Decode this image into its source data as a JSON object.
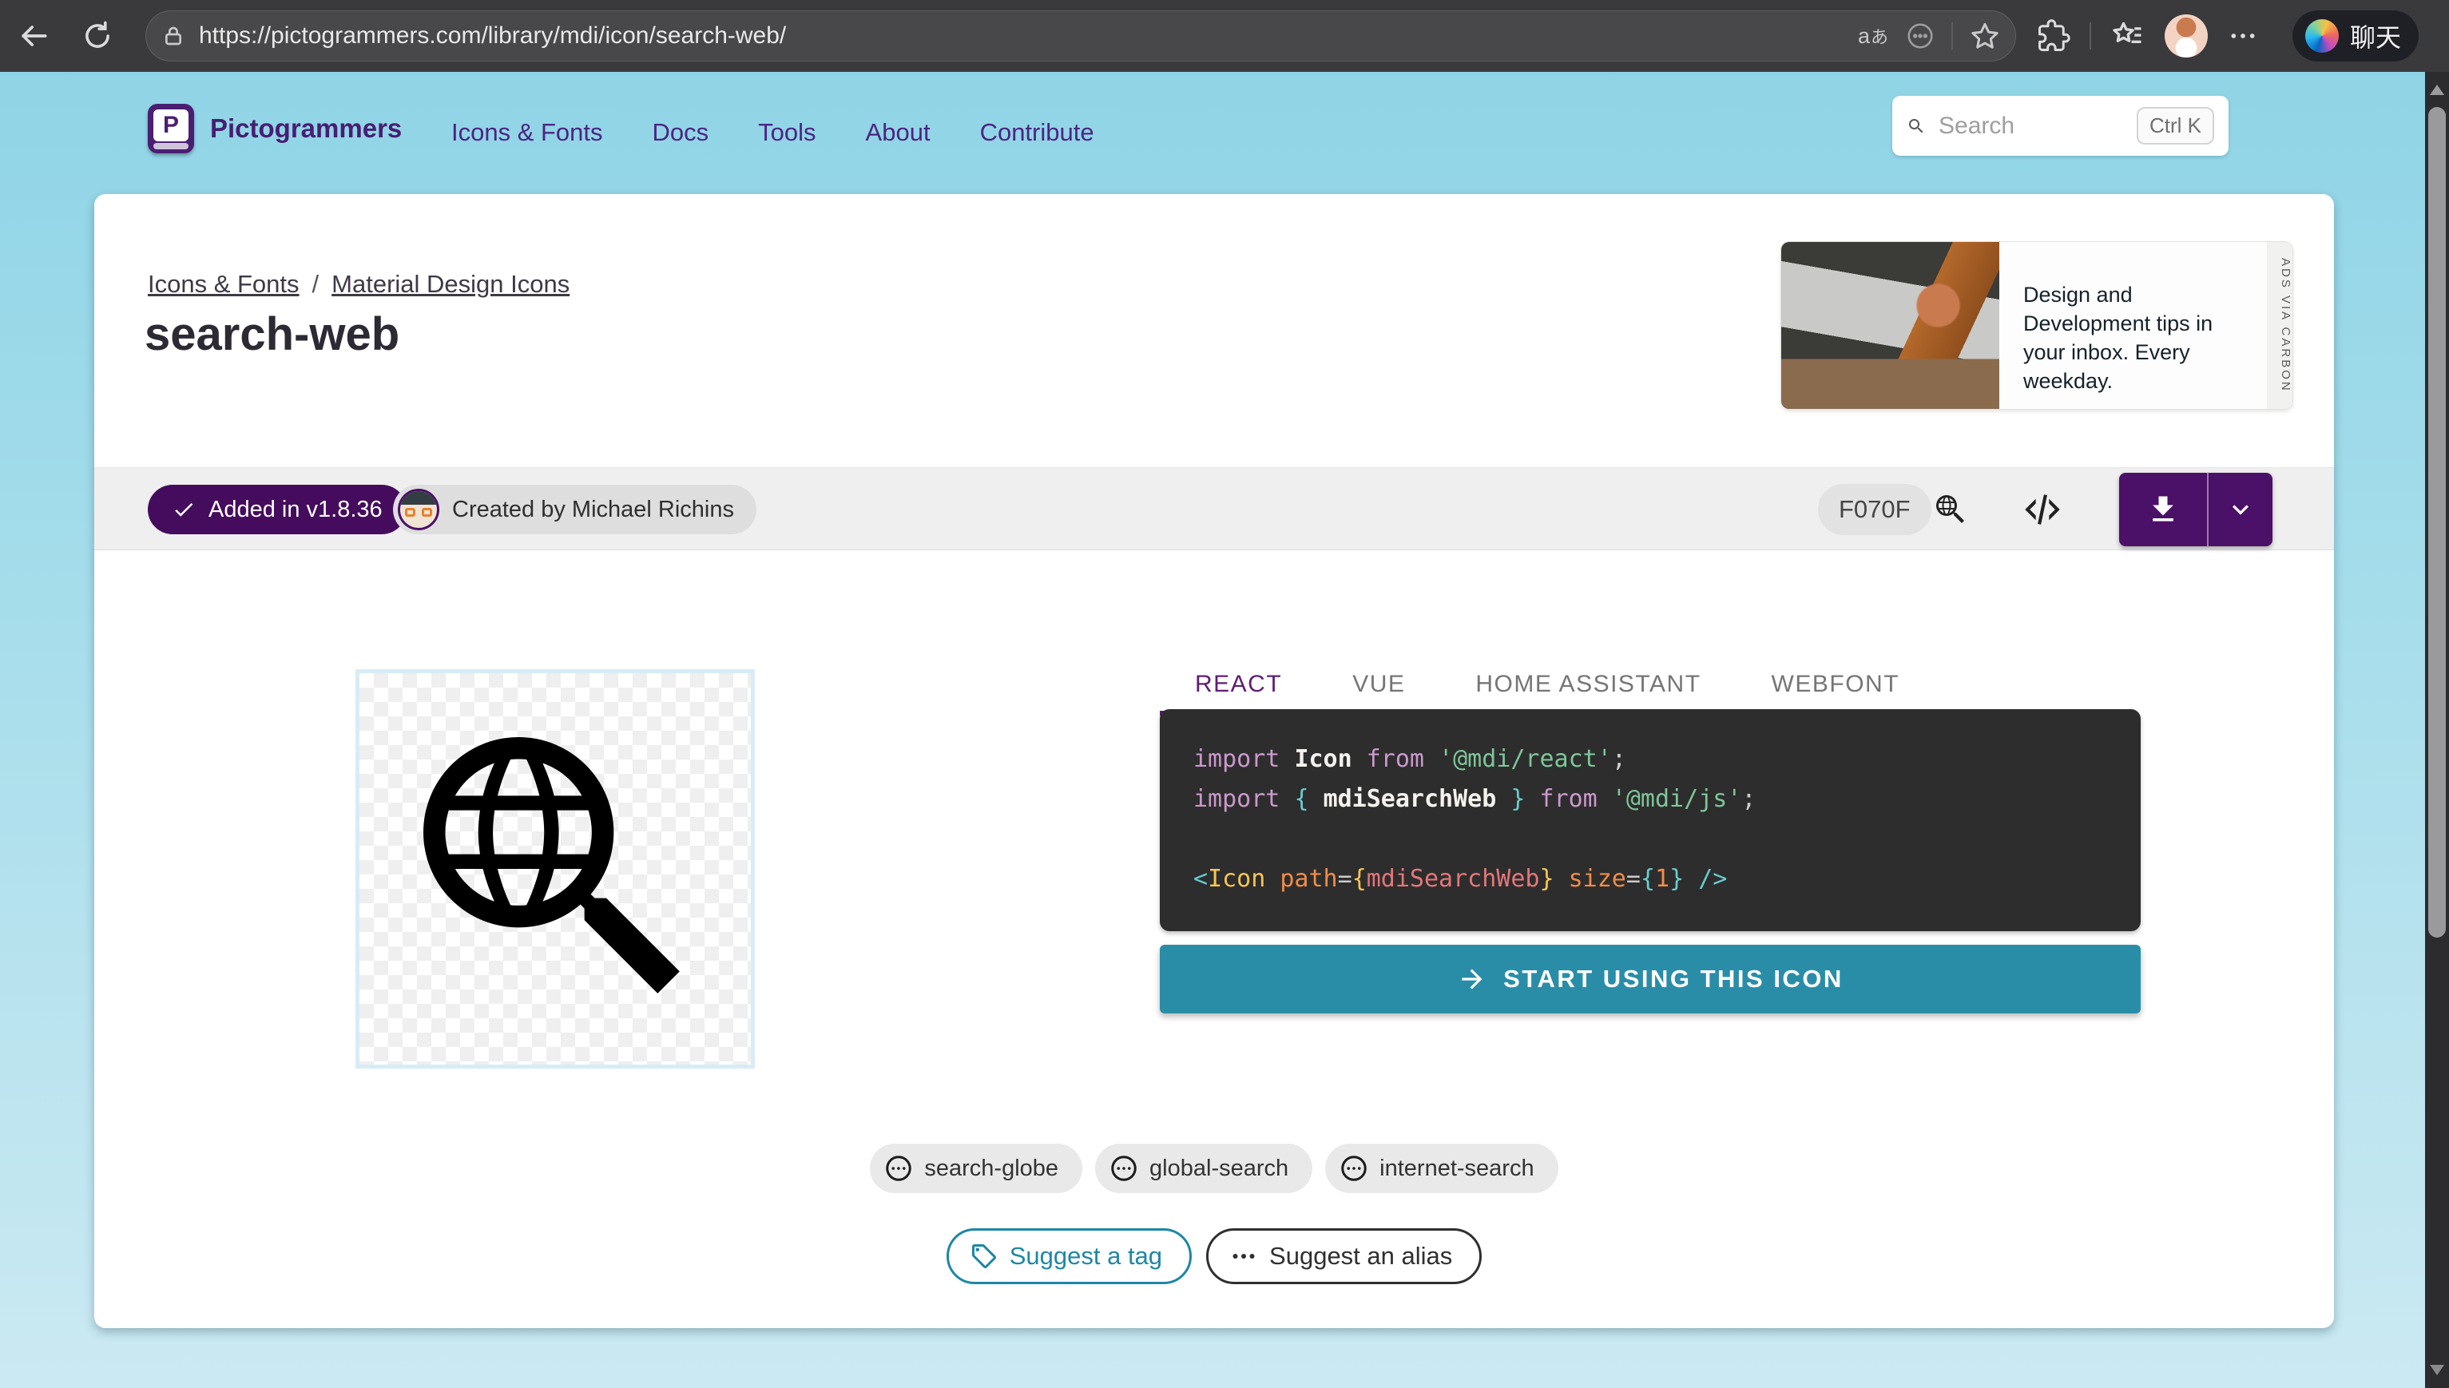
{
  "browser": {
    "url": "https://pictogrammers.com/library/mdi/icon/search-web/",
    "copilot_label": "聊天"
  },
  "header": {
    "brand": "Pictogrammers",
    "nav": [
      {
        "label": "Icons & Fonts"
      },
      {
        "label": "Docs"
      },
      {
        "label": "Tools"
      },
      {
        "label": "About"
      },
      {
        "label": "Contribute"
      }
    ],
    "search": {
      "placeholder": "Search",
      "shortcut": "Ctrl K"
    }
  },
  "breadcrumb": {
    "separator": "/",
    "items": [
      {
        "label": "Icons & Fonts"
      },
      {
        "label": "Material Design Icons"
      }
    ]
  },
  "page": {
    "title": "search-web"
  },
  "ad": {
    "text": "Design and Development tips in your inbox. Every weekday.",
    "attribution": "ADS VIA CARBON"
  },
  "meta": {
    "added_badge": "Added in v1.8.36",
    "author_badge": "Created by Michael Richins",
    "hex_code": "F070F"
  },
  "tabs": [
    {
      "label": "REACT",
      "active": true
    },
    {
      "label": "VUE",
      "active": false
    },
    {
      "label": "HOME ASSISTANT",
      "active": false
    },
    {
      "label": "WEBFONT",
      "active": false
    }
  ],
  "code": {
    "lines": [
      [
        {
          "t": "import",
          "c": "kw"
        },
        {
          "t": " ",
          "c": "pun"
        },
        {
          "t": "Icon",
          "c": "id"
        },
        {
          "t": " ",
          "c": "pun"
        },
        {
          "t": "from",
          "c": "kw"
        },
        {
          "t": " ",
          "c": "pun"
        },
        {
          "t": "'@mdi/react'",
          "c": "str"
        },
        {
          "t": ";",
          "c": "pun"
        }
      ],
      [
        {
          "t": "import",
          "c": "kw"
        },
        {
          "t": " ",
          "c": "pun"
        },
        {
          "t": "{",
          "c": "cy"
        },
        {
          "t": " ",
          "c": "pun"
        },
        {
          "t": "mdiSearchWeb",
          "c": "id"
        },
        {
          "t": " ",
          "c": "pun"
        },
        {
          "t": "}",
          "c": "cy"
        },
        {
          "t": " ",
          "c": "pun"
        },
        {
          "t": "from",
          "c": "kw"
        },
        {
          "t": " ",
          "c": "pun"
        },
        {
          "t": "'@mdi/js'",
          "c": "str"
        },
        {
          "t": ";",
          "c": "pun"
        }
      ],
      [],
      [
        {
          "t": "<",
          "c": "cy"
        },
        {
          "t": "Icon",
          "c": "yel"
        },
        {
          "t": " ",
          "c": "pun"
        },
        {
          "t": "path",
          "c": "or"
        },
        {
          "t": "=",
          "c": "pun"
        },
        {
          "t": "{",
          "c": "yel"
        },
        {
          "t": "mdiSearchWeb",
          "c": "red"
        },
        {
          "t": "}",
          "c": "yel"
        },
        {
          "t": " ",
          "c": "pun"
        },
        {
          "t": "size",
          "c": "or"
        },
        {
          "t": "=",
          "c": "pun"
        },
        {
          "t": "{",
          "c": "cy"
        },
        {
          "t": "1",
          "c": "or"
        },
        {
          "t": "}",
          "c": "cy"
        },
        {
          "t": " ",
          "c": "pun"
        },
        {
          "t": "/>",
          "c": "cy"
        }
      ]
    ]
  },
  "cta": {
    "label": "START USING THIS ICON"
  },
  "tags": [
    {
      "label": "search-globe"
    },
    {
      "label": "global-search"
    },
    {
      "label": "internet-search"
    }
  ],
  "suggest": {
    "tag_label": "Suggest a tag",
    "alias_label": "Suggest an alias"
  },
  "colors": {
    "brand_purple": "#4B2583",
    "badge_purple": "#450C5D",
    "download_purple": "#4B1068",
    "cta_teal": "#2A8DA8",
    "tab_active_purple": "#5F1D75",
    "code_background": "#2D2D2D",
    "header_blue": "#8FD4E6",
    "page_blue_bottom": "#CBE9F2"
  }
}
